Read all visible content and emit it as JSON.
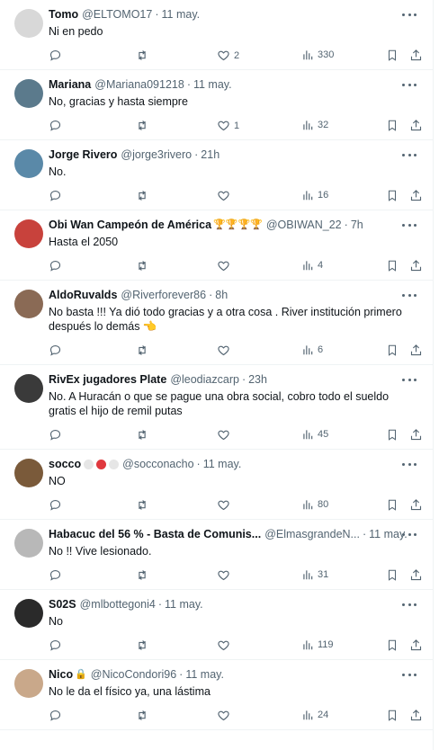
{
  "replies": [
    {
      "name": "Tomo",
      "handle": "@ELTOMO17",
      "time": "11 may.",
      "text": "Ni en pedo",
      "likes": "2",
      "views": "330",
      "avatar_color": "#d8d8d8"
    },
    {
      "name": "Mariana",
      "handle": "@Mariana091218",
      "time": "11 may.",
      "text": "No, gracias y hasta siempre",
      "likes": "1",
      "views": "32",
      "avatar_color": "#5b7a8c"
    },
    {
      "name": "Jorge Rivero",
      "handle": "@jorge3rivero",
      "time": "21h",
      "text": "No.",
      "likes": "",
      "views": "16",
      "avatar_color": "#5a89a8"
    },
    {
      "name": "Obi Wan Campeón de América",
      "name_suffix": "🏆🏆🏆🏆",
      "handle": "@OBIWAN_22",
      "time": "7h",
      "text": "Hasta el 2050",
      "likes": "",
      "views": "4",
      "avatar_color": "#c8423c"
    },
    {
      "name": "AldoRuvalds",
      "handle": "@Riverforever86",
      "time": "8h",
      "text": "No basta !!! Ya dió todo gracias y a otra cosa . River institución primero después lo demás 👈",
      "likes": "",
      "views": "6",
      "avatar_color": "#8a6a55"
    },
    {
      "name": "RivEx jugadores Plate",
      "handle": "@leodiazcarp",
      "time": "23h",
      "text": "No. A Huracán o que se pague una obra social, cobro todo el sueldo gratis el hijo de remil putas",
      "likes": "",
      "views": "45",
      "avatar_color": "#3a3a3a"
    },
    {
      "name": "socco",
      "handle": "@socconacho",
      "time": "11 may.",
      "text": "NO",
      "likes": "",
      "views": "80",
      "avatar_color": "#7a5a3a"
    },
    {
      "name": "Habacuc del 56 % - Basta de Comunis...",
      "handle": "@ElmasgrandeN...",
      "time": "11 may.",
      "text": "No !! Vive lesionado.",
      "likes": "",
      "views": "31",
      "avatar_color": "#b8b8b8"
    },
    {
      "name": "S02S",
      "handle": "@mlbottegoni4",
      "time": "11 may.",
      "text": "No",
      "likes": "",
      "views": "119",
      "avatar_color": "#2a2a2a"
    },
    {
      "name": "Nico",
      "name_suffix": "🔒",
      "handle": "@NicoCondori96",
      "time": "11 may.",
      "text": "No le da el físico ya, una lástima",
      "likes": "",
      "views": "24",
      "avatar_color": "#c9a88a"
    }
  ],
  "colors": {
    "icon": "#536471",
    "divider": "#eff3f4",
    "text": "#0f1419"
  },
  "icons": [
    "reply-icon",
    "retweet-icon",
    "like-icon",
    "views-icon",
    "bookmark-icon",
    "share-icon",
    "more-icon"
  ]
}
